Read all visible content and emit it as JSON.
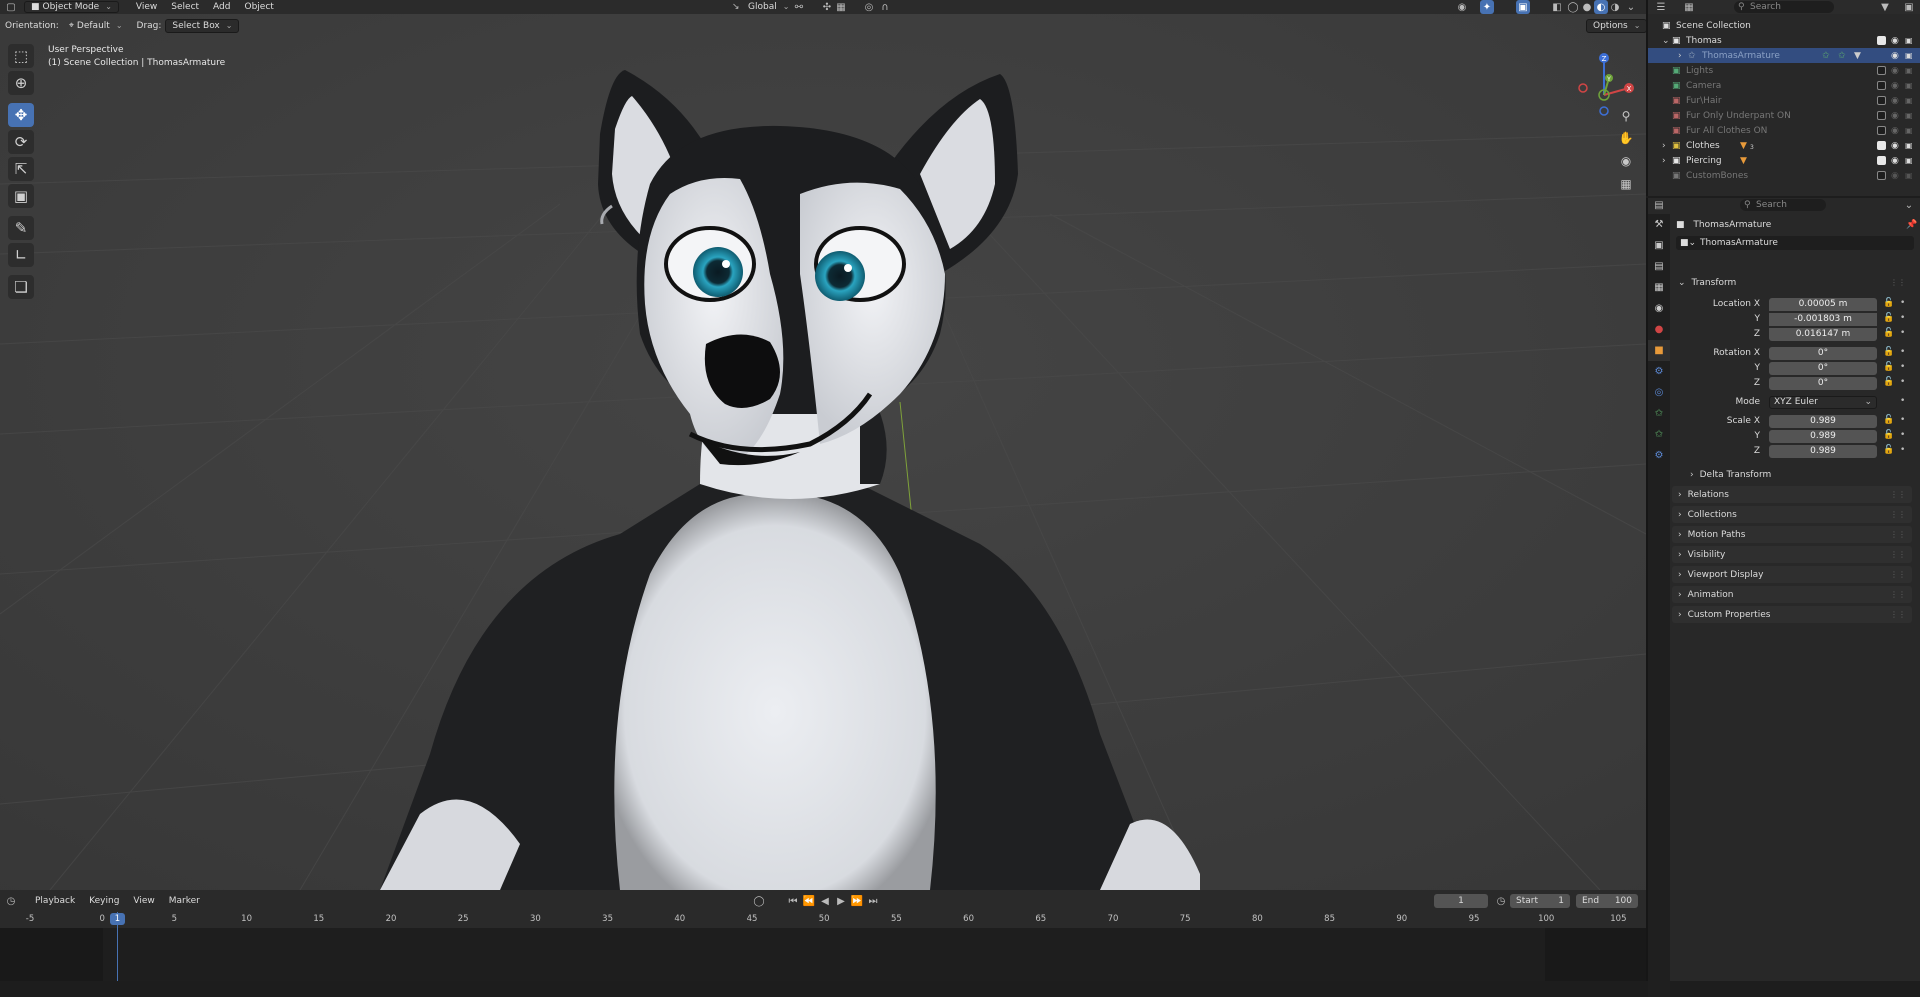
{
  "top": {
    "mode": "Object Mode",
    "menus": [
      "View",
      "Select",
      "Add",
      "Object"
    ],
    "transform_space": "Global",
    "search_placeholder": "Search"
  },
  "viewport": {
    "orientation_label": "Orientation:",
    "orientation_value": "Default",
    "drag_label": "Drag:",
    "drag_value": "Select Box",
    "options_label": "Options",
    "perspective": "User Perspective",
    "collection_path": "(1) Scene Collection | ThomasArmature",
    "gizmo_axes": [
      "Z",
      "Y",
      "X"
    ]
  },
  "outliner": {
    "search_placeholder": "Search",
    "items": [
      {
        "label": "Scene Collection"
      },
      {
        "label": "Thomas"
      },
      {
        "label": "ThomasArmature"
      },
      {
        "label": "Lights"
      },
      {
        "label": "Camera"
      },
      {
        "label": "Fur\\Hair"
      },
      {
        "label": "Fur Only Underpant ON"
      },
      {
        "label": "Fur All Clothes ON"
      },
      {
        "label": "Clothes",
        "badge": "3"
      },
      {
        "label": "Piercing"
      },
      {
        "label": "CustomBones"
      }
    ]
  },
  "properties": {
    "search_placeholder": "Search",
    "object_name": "ThomasArmature",
    "object_field": "ThomasArmature",
    "transform_title": "Transform",
    "location_label": "Location X",
    "location": [
      "0.00005 m",
      "-0.001803 m",
      "0.016147 m"
    ],
    "rotation_label": "Rotation X",
    "rotation": [
      "0°",
      "0°",
      "0°"
    ],
    "mode_label": "Mode",
    "mode_value": "XYZ Euler",
    "scale_label": "Scale X",
    "scale": [
      "0.989",
      "0.989",
      "0.989"
    ],
    "y_label": "Y",
    "z_label": "Z",
    "delta_transform": "Delta Transform",
    "panels": [
      "Relations",
      "Collections",
      "Motion Paths",
      "Visibility",
      "Viewport Display",
      "Animation",
      "Custom Properties"
    ]
  },
  "timeline": {
    "menus": [
      "Playback",
      "Keying",
      "View",
      "Marker"
    ],
    "current_frame": "1",
    "start_label": "Start",
    "start_value": "1",
    "end_label": "End",
    "end_value": "100",
    "ruler_ticks": [
      "-5",
      "0",
      "5",
      "10",
      "15",
      "20",
      "25",
      "30",
      "35",
      "40",
      "45",
      "50",
      "55",
      "60",
      "65",
      "70",
      "75",
      "80",
      "85",
      "90",
      "95",
      "100",
      "105"
    ],
    "playhead_label": "1"
  },
  "colors": {
    "accent": "#4772b3",
    "viewport_bg": "#3b3b3b",
    "collection_white": "#e8e8e8",
    "armature_green": "#5fb06b"
  }
}
